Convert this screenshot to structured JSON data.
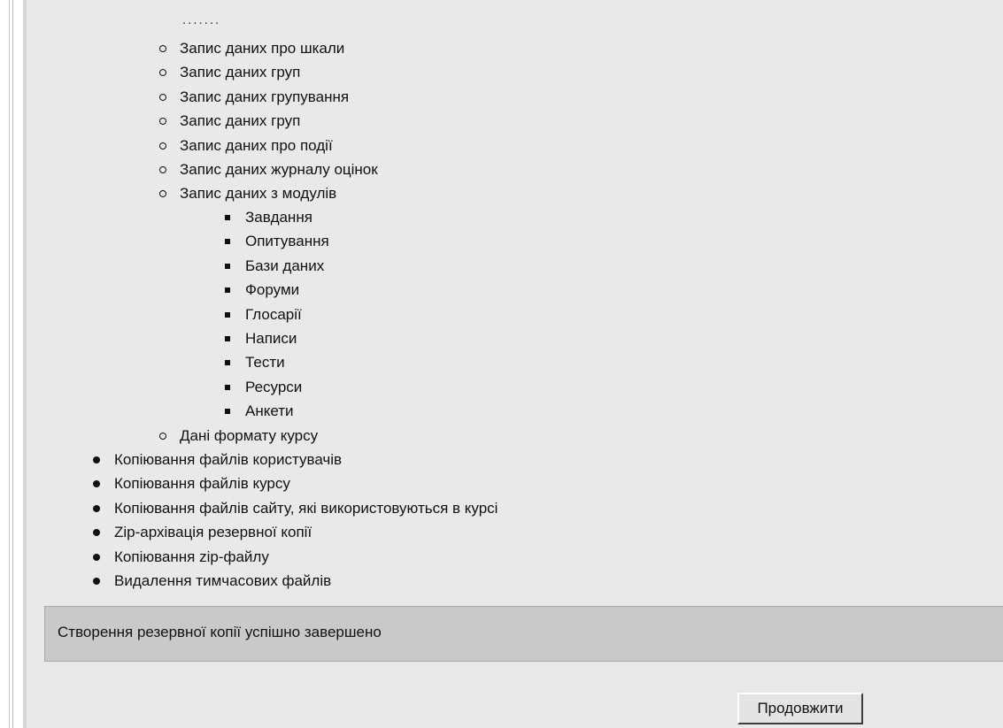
{
  "progress": {
    "ellipsis": ".......",
    "level2_items_before": [
      "Запис даних про шкали",
      "Запис даних груп",
      "Запис даних групування",
      "Запис даних груп",
      "Запис даних про події",
      "Запис даних журналу оцінок",
      "Запис даних з модулів"
    ],
    "module_items": [
      "Завдання",
      "Опитування",
      "Бази даних",
      "Форуми",
      "Глосарії",
      "Написи",
      "Тести",
      "Ресурси",
      "Анкети"
    ],
    "level2_items_after": [
      "Дані формату курсу"
    ],
    "top_items": [
      "Копіювання файлів користувачів",
      "Копіювання файлів курсу",
      "Копіювання файлів сайту, які використовуються в курсі",
      "Zip-архівація резервної копії",
      "Копіювання zip-файлу",
      "Видалення тимчасових файлів"
    ]
  },
  "status": {
    "message": "Створення резервної копії успішно завершено"
  },
  "actions": {
    "continue_label": "Продовжити"
  }
}
